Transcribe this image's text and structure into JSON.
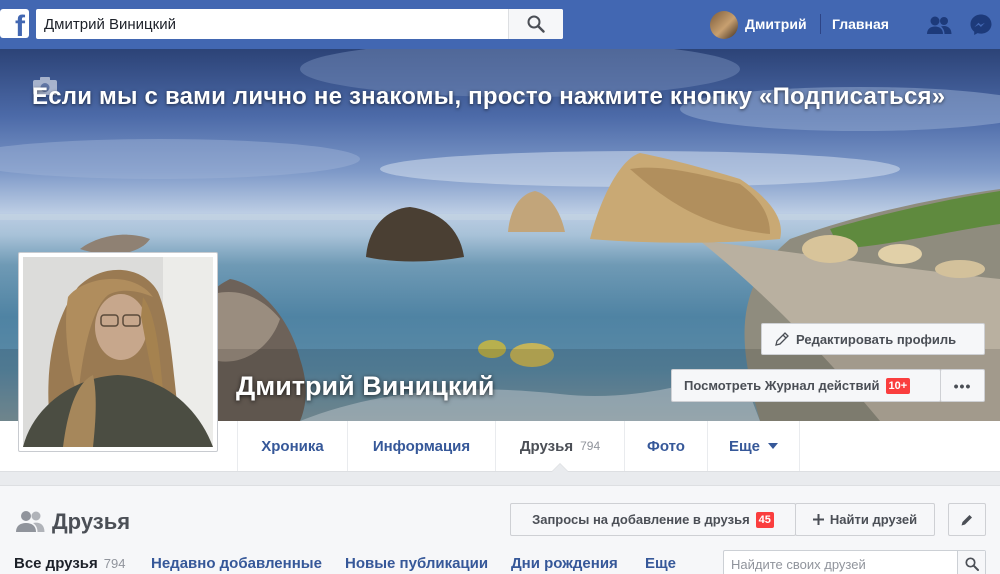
{
  "topbar": {
    "logo": "f",
    "search_value": "Дмитрий Виницкий",
    "user_name": "Дмитрий",
    "home_label": "Главная",
    "icons": [
      "search-icon",
      "friend-requests-icon",
      "messenger-icon"
    ]
  },
  "cover": {
    "caption": "Если мы с вами лично не знакомы, просто нажмите кнопку «Подписаться»",
    "name": "Дмитрий Виницкий",
    "edit_profile_label": "Редактировать профиль",
    "activity_log_label": "Посмотреть Журнал действий",
    "activity_log_badge": "10+",
    "more_label": "•••"
  },
  "tabs": [
    {
      "label": "Хроника"
    },
    {
      "label": "Информация"
    },
    {
      "label": "Друзья",
      "count": "794"
    },
    {
      "label": "Фото"
    },
    {
      "label": "Еще"
    }
  ],
  "friends": {
    "title": "Друзья",
    "requests_label": "Запросы на добавление в друзья",
    "requests_badge": "45",
    "find_label": "Найти друзей",
    "subnav": [
      {
        "label": "Все друзья",
        "count": "794"
      },
      {
        "label": "Недавно добавленные"
      },
      {
        "label": "Новые публикации"
      },
      {
        "label": "Дни рождения"
      },
      {
        "label": "Еще"
      }
    ],
    "search_placeholder": "Найдите своих друзей"
  },
  "colors": {
    "topbar": "#4267b2",
    "link": "#365899",
    "badge": "#fa3e3e",
    "page_bg": "#e9ebee"
  }
}
